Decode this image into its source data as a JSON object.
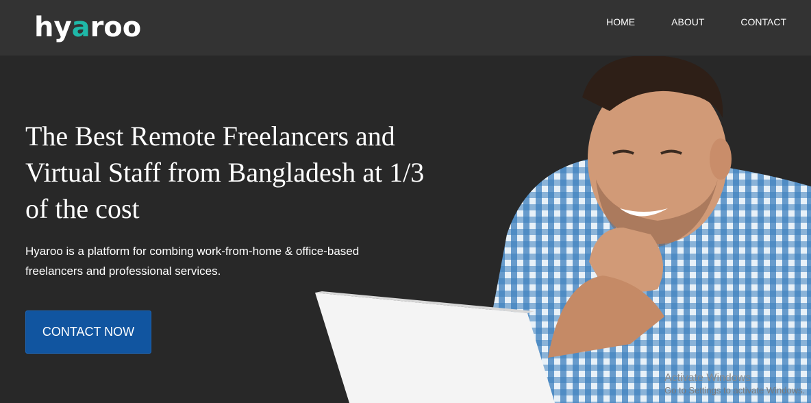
{
  "header": {
    "logo_pre": "hy",
    "logo_mid": "a",
    "logo_post": "roo",
    "logo_accent": "#1fb8a8",
    "nav": [
      {
        "label": "HOME"
      },
      {
        "label": "ABOUT"
      },
      {
        "label": "CONTACT"
      }
    ]
  },
  "hero": {
    "title": "The Best Remote Freelancers and Virtual Staff from Bangladesh at 1/3 of the cost",
    "subtitle": "Hyaroo is a platform for combing work-from-home & office-based freelancers and professional services.",
    "cta_label": "CONTACT NOW",
    "cta_color": "#1155a0"
  },
  "watermark": {
    "line1": "Activate Windows",
    "line2": "Go to Settings to activate Windows."
  },
  "colors": {
    "background": "#282828",
    "header_bg": "#333333"
  }
}
